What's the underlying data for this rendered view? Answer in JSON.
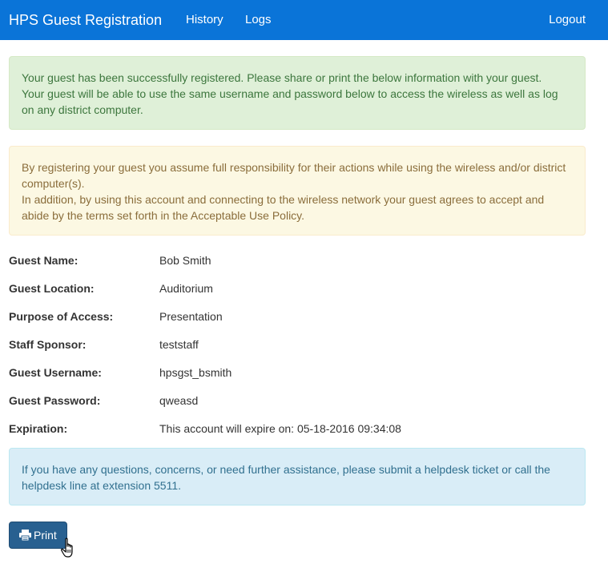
{
  "navbar": {
    "brand": "HPS Guest Registration",
    "links": [
      "History",
      "Logs"
    ],
    "logout": "Logout",
    "background_color": "#0a74d8"
  },
  "success_alert": {
    "lines": [
      "Your guest has been successfully registered. Please share or print the below information with your guest.",
      "Your guest will be able to use the same username and password below to access the wireless as well as log on any district computer."
    ]
  },
  "warning_alert": {
    "lines": [
      "By registering your guest you assume full responsibility for their actions while using the wireless and/or district computer(s).",
      "In addition, by using this account and connecting to the wireless network your guest agrees to accept and abide by the terms set forth in the Acceptable Use Policy."
    ]
  },
  "details": [
    {
      "label": "Guest Name:",
      "value": "Bob Smith"
    },
    {
      "label": "Guest Location:",
      "value": "Auditorium"
    },
    {
      "label": "Purpose of Access:",
      "value": "Presentation"
    },
    {
      "label": "Staff Sponsor:",
      "value": "teststaff"
    },
    {
      "label": "Guest Username:",
      "value": "hpsgst_bsmith"
    },
    {
      "label": "Guest Password:",
      "value": "qweasd"
    },
    {
      "label": "Expiration:",
      "value": "This account will expire on: 05-18-2016 09:34:08"
    }
  ],
  "info_alert": {
    "text": "If you have any questions, concerns, or need further assistance, please submit a helpdesk ticket or call the helpdesk line at extension 5511."
  },
  "print_button": {
    "label": "Print",
    "icon": "printer-icon",
    "color": "#286090"
  },
  "cursor": {
    "icon": "hand-pointer-icon"
  }
}
